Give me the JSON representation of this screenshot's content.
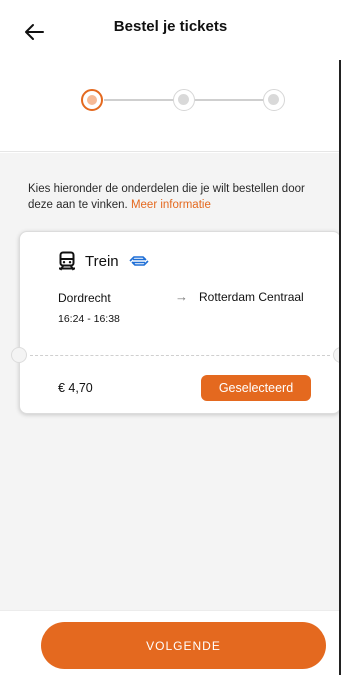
{
  "header": {
    "title": "Bestel je tickets",
    "back_icon": "arrow-left-icon"
  },
  "stepper": {
    "current_step": 1,
    "total_steps": 3,
    "active_color": "#e4691f"
  },
  "intro": {
    "text": "Kies hieronder de onderdelen die je wilt bestellen door deze aan te vinken.",
    "link": "Meer informatie"
  },
  "ticket": {
    "mode_icon": "train-icon",
    "mode": "Trein",
    "operator_icon": "ns-logo-icon",
    "from": "Dordrecht",
    "times": "16:24 - 16:38",
    "arrow": "→",
    "to": "Rotterdam Centraal",
    "price": "€ 4,70",
    "status_label": "Geselecteerd"
  },
  "footer": {
    "next_label": "VOLGENDE"
  },
  "colors": {
    "accent": "#e4691f",
    "ns_blue": "#1f6fd6"
  }
}
